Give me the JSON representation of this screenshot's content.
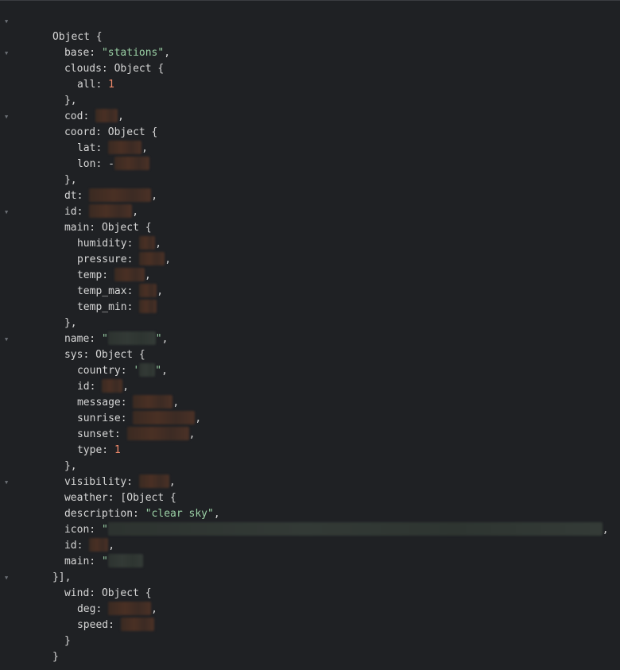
{
  "console": {
    "labels": {
      "object": "Object",
      "open_brace": " {",
      "close_brace": "}",
      "close_brace_comma": "},",
      "close_array": "}],",
      "comma": ",",
      "array_open": "[Object {"
    },
    "fields": {
      "base": {
        "key": "base: ",
        "value": "\"stations\""
      },
      "clouds": {
        "key": "clouds: "
      },
      "clouds_all": {
        "key": "all: ",
        "value": "1"
      },
      "cod": {
        "key": "cod: "
      },
      "coord": {
        "key": "coord: "
      },
      "lat": {
        "key": "lat: "
      },
      "lon": {
        "key": "lon: ",
        "prefix": "-"
      },
      "dt": {
        "key": "dt: "
      },
      "id": {
        "key": "id: "
      },
      "main": {
        "key": "main: "
      },
      "humidity": {
        "key": "humidity: "
      },
      "pressure": {
        "key": "pressure: "
      },
      "temp": {
        "key": "temp: "
      },
      "temp_max": {
        "key": "temp_max: "
      },
      "temp_min": {
        "key": "temp_min: "
      },
      "name": {
        "key": "name: ",
        "quote_open": "\"",
        "quote_close": "\""
      },
      "sys": {
        "key": "sys: "
      },
      "country": {
        "key": "country: ",
        "quote_open": "'",
        "quote_close": "\""
      },
      "sys_id": {
        "key": "id: "
      },
      "message": {
        "key": "message: "
      },
      "sunrise": {
        "key": "sunrise: "
      },
      "sunset": {
        "key": "sunset: "
      },
      "type": {
        "key": "type: ",
        "value": "1"
      },
      "visibility": {
        "key": "visibility: "
      },
      "weather": {
        "key": "weather: "
      },
      "description": {
        "key": "description: ",
        "value": "\"clear sky\""
      },
      "icon": {
        "key": "icon: ",
        "quote_open": "\""
      },
      "weather_id": {
        "key": "id: "
      },
      "weather_main": {
        "key": "main: ",
        "quote_open": "\""
      },
      "wind": {
        "key": "wind: "
      },
      "deg": {
        "key": "deg: "
      },
      "speed": {
        "key": "speed: "
      }
    }
  }
}
